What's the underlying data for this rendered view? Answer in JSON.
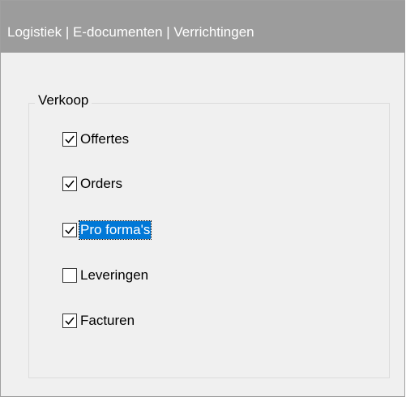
{
  "header": {
    "title": "Logistiek | E-documenten | Verrichtingen"
  },
  "group": {
    "legend": "Verkoop"
  },
  "options": [
    {
      "label": "Offertes",
      "checked": true
    },
    {
      "label": "Orders",
      "checked": true
    },
    {
      "label": "Pro forma's",
      "checked": true,
      "focused": true
    },
    {
      "label": "Leveringen",
      "checked": false
    },
    {
      "label": "Facturen",
      "checked": true
    }
  ],
  "colors": {
    "header_bg": "#9c9c9c",
    "panel_bg": "#f0f0f0",
    "selection_bg": "#0078d7"
  }
}
